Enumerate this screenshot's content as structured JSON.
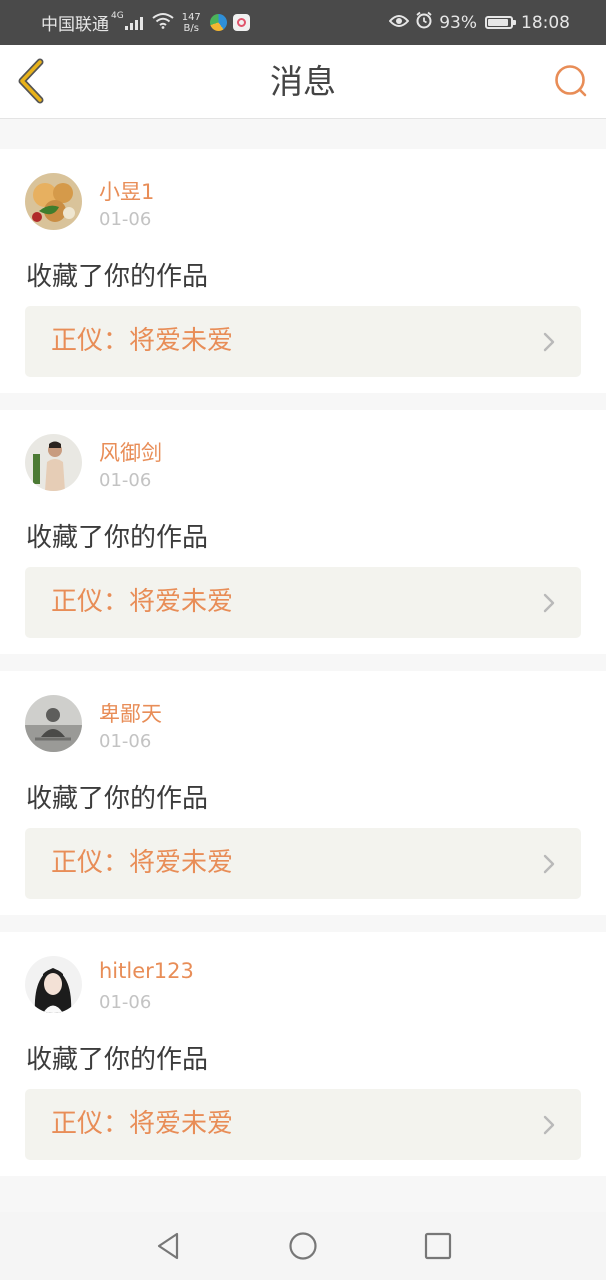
{
  "status_bar": {
    "carrier": "中国联通",
    "network_type": "4G",
    "net_speed_value": "147",
    "net_speed_unit": "B/s",
    "battery_percent": "93%",
    "battery_level": 0.93,
    "time": "18:08"
  },
  "header": {
    "title": "消息"
  },
  "messages": [
    {
      "username": "小昱1",
      "date": "01-06",
      "action": "收藏了你的作品",
      "work_title": "正仪：将爱未爱"
    },
    {
      "username": "风御剑",
      "date": "01-06",
      "action": "收藏了你的作品",
      "work_title": "正仪：将爱未爱"
    },
    {
      "username": "卑鄙天",
      "date": "01-06",
      "action": "收藏了你的作品",
      "work_title": "正仪：将爱未爱"
    },
    {
      "username": "hitler123",
      "date": "01-06",
      "action": "收藏了你的作品",
      "work_title": "正仪：将爱未爱"
    }
  ],
  "colors": {
    "accent_orange": "#e88d57",
    "back_arrow_yellow": "#e8b21a",
    "link_background": "#f3f3ee"
  },
  "icons": {
    "back": "back-arrow-icon",
    "search": "search-icon",
    "chevron": "chevron-right-icon",
    "nav_back": "nav-back-icon",
    "nav_home": "nav-home-icon",
    "nav_recents": "nav-recents-icon"
  }
}
